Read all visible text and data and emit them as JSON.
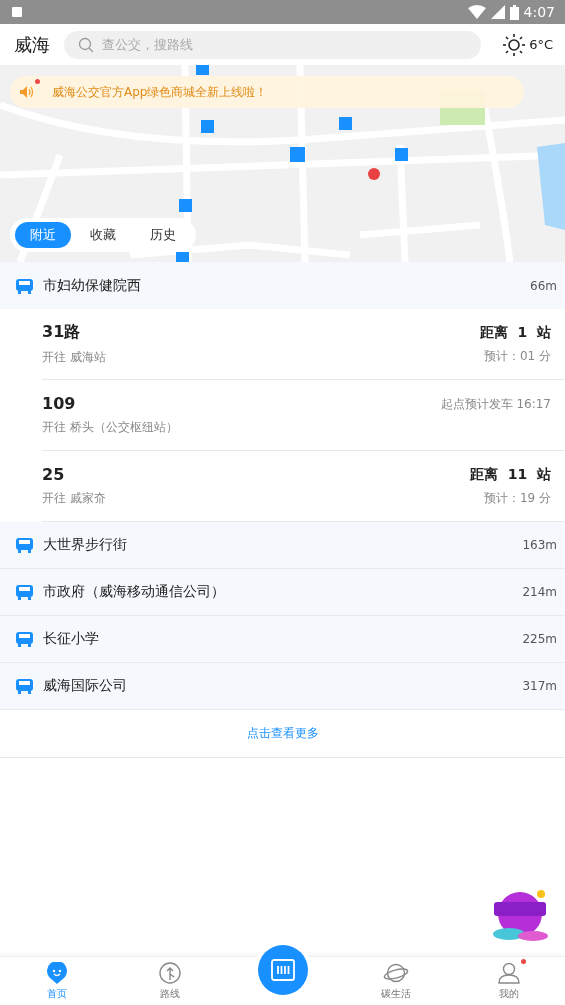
{
  "status_bar": {
    "time": "4:07"
  },
  "header": {
    "city": "威海",
    "search_placeholder": "查公交，搜路线",
    "weather": "6°C"
  },
  "notice": {
    "text": "威海公交官方App绿色商城全新上线啦！",
    "unread": true
  },
  "map_tabs": [
    {
      "label": "附近",
      "selected": true
    },
    {
      "label": "收藏",
      "selected": false
    },
    {
      "label": "历史",
      "selected": false
    }
  ],
  "nearest_stop": {
    "name": "市妇幼保健院西",
    "distance": "66m",
    "routes": [
      {
        "kind": "distance",
        "name": "31路",
        "destination": "开往 威海站",
        "distance": "距离  1  站",
        "eta": "预计：01 分"
      },
      {
        "kind": "departure",
        "name": "109",
        "destination": "开往 桥头（公交枢纽站）",
        "departure": "起点预计发车 16:17"
      },
      {
        "kind": "distance",
        "name": "25",
        "destination": "开往 戚家夼",
        "distance": "距离  11  站",
        "eta": "预计：19 分"
      }
    ]
  },
  "other_stops": [
    {
      "name": "大世界步行街",
      "distance": "163m"
    },
    {
      "name": "市政府（威海移动通信公司）",
      "distance": "214m"
    },
    {
      "name": "长征小学",
      "distance": "225m"
    },
    {
      "name": "威海国际公司",
      "distance": "317m"
    }
  ],
  "more_link": "点击查看更多",
  "bottom_nav": [
    {
      "kind": "home",
      "label": "首页",
      "selected": true,
      "unread": false
    },
    {
      "kind": "route",
      "label": "路线",
      "selected": false,
      "unread": false
    },
    {
      "kind": "scan",
      "selected": false
    },
    {
      "kind": "planet",
      "label": "碳生活",
      "selected": false,
      "unread": false
    },
    {
      "kind": "profile",
      "label": "我的",
      "selected": false,
      "unread": true
    }
  ]
}
